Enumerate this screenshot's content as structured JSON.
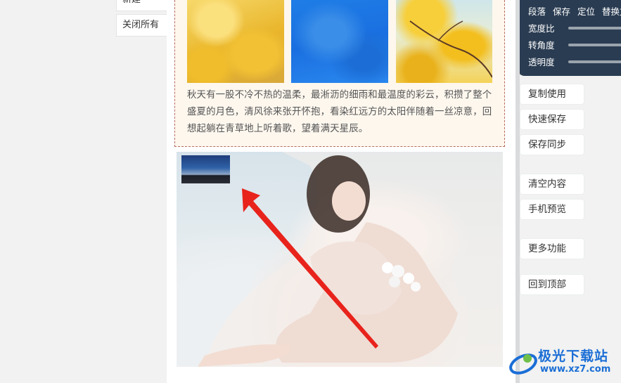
{
  "left_buttons": {
    "top_label": "新建",
    "close_label": "关闭所有"
  },
  "article": {
    "text": "秋天有一股不冷不热的温柔，最淅沥的细雨和最温度的彩云，积攒了整个盛夏的月色，清风徐来张开怀抱，看染红远方的太阳伴随着一丝凉意，回想起躺在青草地上听着歌，望着满天星辰。"
  },
  "tool_panel": {
    "links": [
      "段落",
      "保存",
      "定位",
      "替换文"
    ],
    "sliders": [
      "宽度比",
      "转角度",
      "透明度"
    ]
  },
  "side_buttons": {
    "copy": "复制使用",
    "quick_save": "快速保存",
    "save_sync": "保存同步",
    "clear": "清空内容",
    "preview": "手机预览",
    "more": "更多功能",
    "top": "回到顶部"
  },
  "watermark": {
    "name": "极光下载站",
    "url": "www.xz7.com"
  },
  "colors": {
    "panel_dark": "#2a3c52",
    "arrow": "#e8231c",
    "watermark": "#1b6ed6"
  }
}
